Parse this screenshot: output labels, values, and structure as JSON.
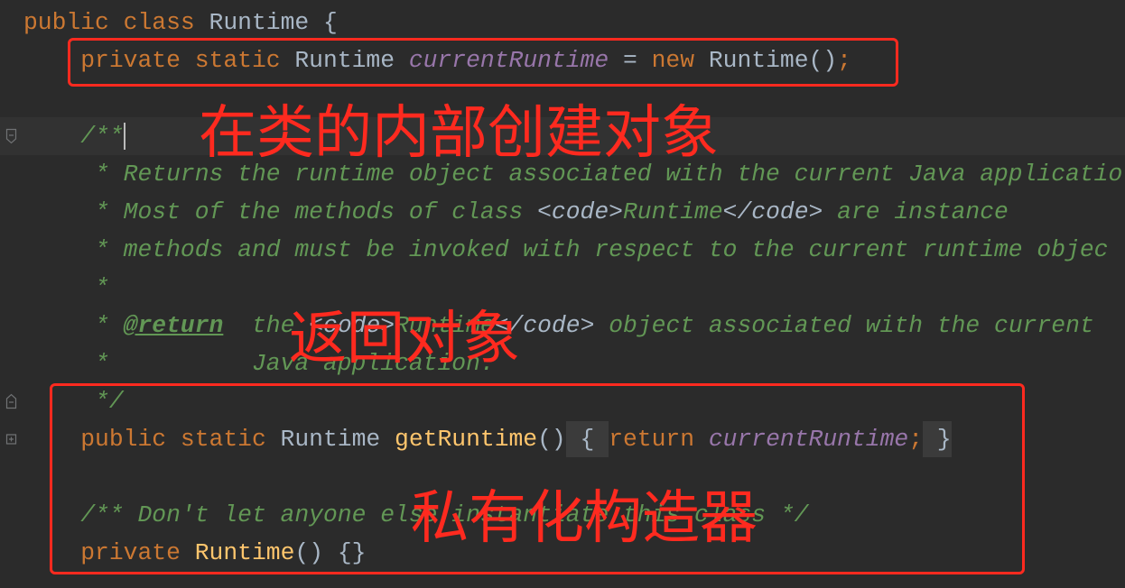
{
  "theme": {
    "background": "#2B2B2B",
    "current_line": "#323232",
    "text": "#A9B7C6",
    "keyword": "#CC7832",
    "field": "#9876AA",
    "method": "#FFC66D",
    "doc": "#629755",
    "doc_markup": "#A9B7C6",
    "fold_placeholder_bg": "#3B3B3B",
    "fold_marker": "#707274",
    "caret": "#BBBBBB",
    "annotation": "#FF2A1F"
  },
  "editor": {
    "lines": [
      {
        "tokens": [
          {
            "keyword": "public "
          },
          {
            "keyword": "class"
          },
          {
            "text": " Runtime {"
          }
        ]
      },
      {
        "tokens": [
          {
            "keyword": "    private static"
          },
          {
            "text": " Runtime "
          },
          {
            "field": "currentRuntime"
          },
          {
            "text": " = "
          },
          {
            "keyword": "new"
          },
          {
            "text": " Runtime()"
          },
          {
            "keyword": ";"
          }
        ]
      },
      {
        "tokens": []
      },
      {
        "tokens": [
          {
            "doc": "    /**"
          }
        ],
        "current": true,
        "gutter_icon": "fold-start-icon"
      },
      {
        "tokens": [
          {
            "doc": "     * Returns the runtime object associated with the current Java applicatio"
          }
        ]
      },
      {
        "tokens": [
          {
            "doc": "     * Most of the methods of class "
          },
          {
            "doc_markup": "<code>"
          },
          {
            "doc": "Runtime"
          },
          {
            "doc_markup": "</code>"
          },
          {
            "doc": " are instance"
          }
        ]
      },
      {
        "tokens": [
          {
            "doc": "     * methods and must be invoked with respect to the current runtime objec"
          }
        ]
      },
      {
        "tokens": [
          {
            "doc": "     *"
          }
        ]
      },
      {
        "tokens": [
          {
            "doc": "     * "
          },
          {
            "doc_tag": "@return"
          },
          {
            "doc": "  the "
          },
          {
            "doc_markup": "<code>"
          },
          {
            "doc": "Runtime"
          },
          {
            "doc_markup": "</code>"
          },
          {
            "doc": " object associated with the current"
          }
        ]
      },
      {
        "tokens": [
          {
            "doc": "     *          Java application."
          }
        ]
      },
      {
        "tokens": [
          {
            "doc": "     */"
          }
        ],
        "gutter_icon": "fold-end-icon"
      },
      {
        "tokens": [
          {
            "keyword": "    public static"
          },
          {
            "text": " Runtime "
          },
          {
            "method": "getRuntime"
          },
          {
            "text": "()"
          },
          {
            "fold": " { "
          },
          {
            "keyword": "return "
          },
          {
            "field": "currentRuntime"
          },
          {
            "keyword": ";"
          },
          {
            "fold": " }"
          }
        ],
        "gutter_icon": "fold-collapsed-icon"
      },
      {
        "tokens": []
      },
      {
        "tokens": [
          {
            "doc": "    /** Don't let anyone else instantiate this class */"
          }
        ]
      },
      {
        "tokens": [
          {
            "keyword": "    private "
          },
          {
            "method": "Runtime"
          },
          {
            "text": "() {}"
          }
        ]
      }
    ]
  },
  "annotations": {
    "create_object": "在类的内部创建对象",
    "return_object": "返回对象",
    "private_constructor": "私有化构造器"
  }
}
